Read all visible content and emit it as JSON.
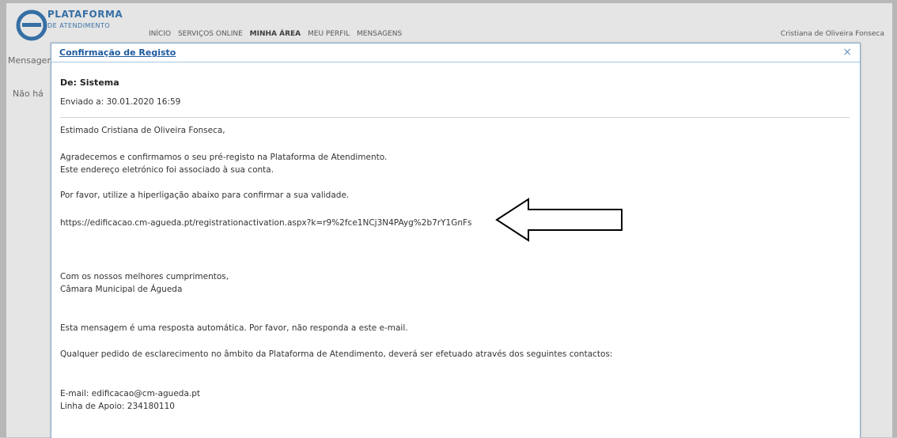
{
  "app": {
    "logo_line1": "PLATAFORMA",
    "logo_line2": "DE ATENDIMENTO",
    "nav_items": [
      "INÍCIO",
      "SERVIÇOS ONLINE",
      "MEU PERFIL",
      "MENSAGENS"
    ],
    "nav_active": "MINHA ÁREA",
    "user_area": "Cristiana de Oliveira Fonseca",
    "crumb": "Mensagens",
    "note": "Não há"
  },
  "dialog": {
    "title": "Confirmação de Registo",
    "close_icon": "×",
    "from": "De: Sistema",
    "sent": "Enviado a: 30.01.2020 16:59",
    "greeting": "Estimado Cristiana de Oliveira Fonseca,",
    "para1_line1": "Agradecemos e confirmamos o seu pré-registo na Plataforma de Atendimento.",
    "para1_line2": "Este endereço eletrónico foi associado à sua conta.",
    "para2": "Por favor, utilize a hiperligação abaixo para confirmar a sua validade.",
    "link": "https://edificacao.cm-agueda.pt/registrationactivation.aspx?k=r9%2fce1NCj3N4PAyg%2b7rY1GnFs",
    "closing1": "Com os nossos melhores cumprimentos,",
    "closing2": "Câmara Municipal de Águeda",
    "auto_msg": "Esta mensagem é uma resposta automática. Por favor, não responda a este e-mail.",
    "contacts_intro": "Qualquer pedido de esclarecimento no âmbito da Plataforma de Atendimento, deverá ser efetuado através dos seguintes contactos:",
    "email": "E-mail: edificacao@cm-agueda.pt",
    "phone": "Linha de Apoio: 234180110"
  },
  "annotation": {
    "icon": "left-arrow-icon"
  }
}
